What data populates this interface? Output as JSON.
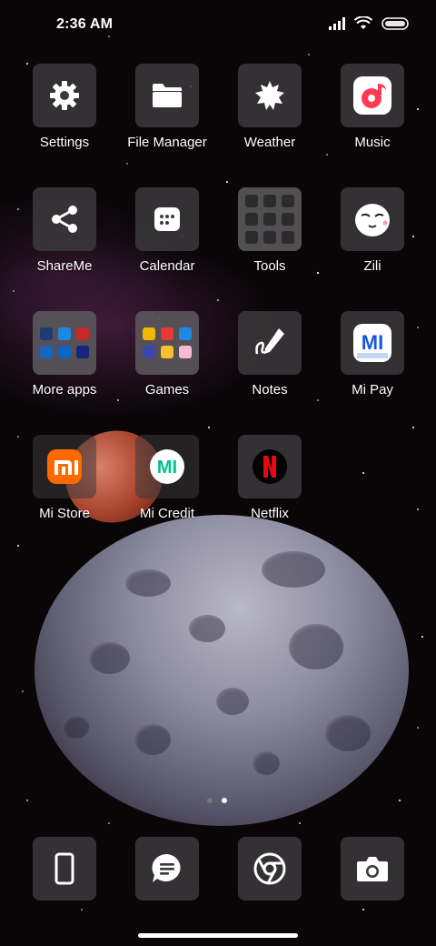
{
  "status_bar": {
    "time": "2:36 AM",
    "icons": [
      "signal-icon",
      "wifi-icon",
      "battery-icon"
    ]
  },
  "apps": [
    {
      "label": "Settings",
      "icon": "gear-icon"
    },
    {
      "label": "File Manager",
      "icon": "folder-icon"
    },
    {
      "label": "Weather",
      "icon": "weather-icon"
    },
    {
      "label": "Music",
      "icon": "music-icon"
    },
    {
      "label": "ShareMe",
      "icon": "share-icon"
    },
    {
      "label": "Calendar",
      "icon": "calendar-icon"
    },
    {
      "label": "Tools",
      "icon": "folder-tools-icon"
    },
    {
      "label": "Zili",
      "icon": "zili-icon"
    },
    {
      "label": "More apps",
      "icon": "folder-more-apps-icon"
    },
    {
      "label": "Games",
      "icon": "folder-games-icon"
    },
    {
      "label": "Notes",
      "icon": "notes-icon"
    },
    {
      "label": "Mi Pay",
      "icon": "mi-pay-icon"
    },
    {
      "label": "Mi Store",
      "icon": "mi-store-icon"
    },
    {
      "label": "Mi Credit",
      "icon": "mi-credit-icon"
    },
    {
      "label": "Netflix",
      "icon": "netflix-icon"
    }
  ],
  "pages": {
    "count": 2,
    "active": 2
  },
  "dock": [
    {
      "icon": "phone-icon"
    },
    {
      "icon": "messages-icon"
    },
    {
      "icon": "chrome-icon"
    },
    {
      "icon": "camera-icon"
    }
  ],
  "colors": {
    "mi_orange": "#ff6a00",
    "netflix_red": "#e50914",
    "mi_credit_green": "#00c08b",
    "mi_pay_blue": "#1a56db",
    "music_red": "#ff3a4e"
  }
}
